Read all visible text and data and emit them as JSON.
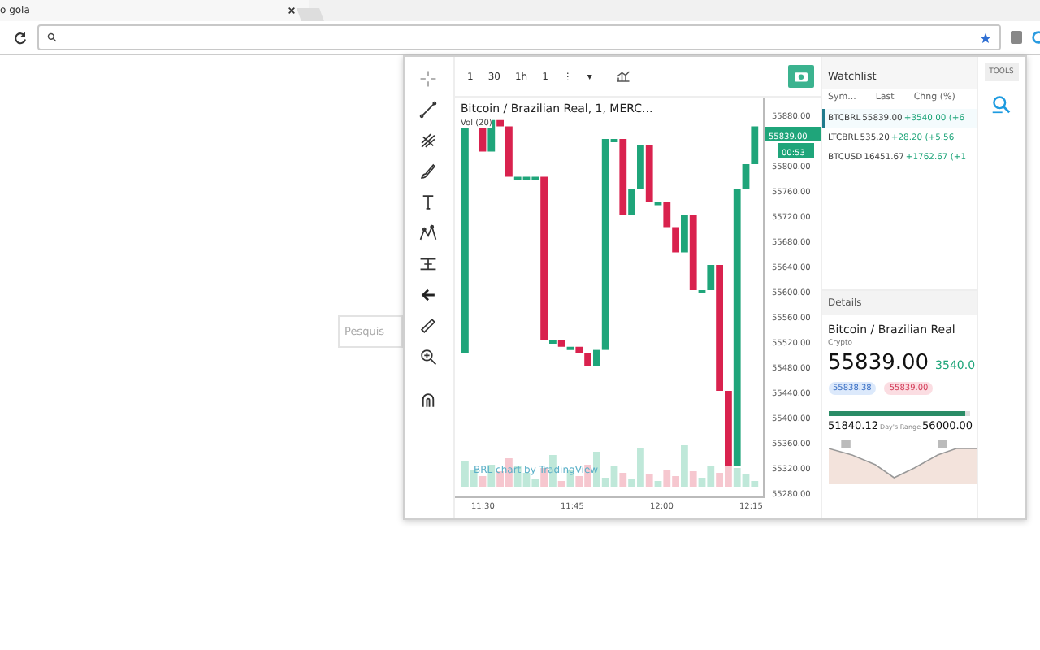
{
  "browser": {
    "tab_title": "o gola"
  },
  "page": {
    "search_placeholder": "Pesquis"
  },
  "chart_toolbar": {
    "items": [
      "1",
      "30",
      "1h",
      "1",
      "⋮",
      "▾"
    ]
  },
  "chart": {
    "legend": "Bitcoin / Brazilian Real, 1, MERC...",
    "volume_label": "Vol (20)",
    "attribution": "BRL chart by TradingView",
    "price_labels": [
      "55880.00",
      "55800.00",
      "55760.00",
      "55720.00",
      "55680.00",
      "55640.00",
      "55600.00",
      "55560.00",
      "55520.00",
      "55480.00",
      "55440.00",
      "55400.00",
      "55360.00",
      "55320.00",
      "55280.00"
    ],
    "last_price": "55839.00",
    "countdown": "00:53",
    "time_labels": [
      "11:30",
      "11:45",
      "12:00",
      "12:15"
    ]
  },
  "watchlist": {
    "title": "Watchlist",
    "columns": [
      "Sym...",
      "Last",
      "Chng (%)"
    ],
    "rows": [
      {
        "symbol": "BTCBRL",
        "last": "55839.00",
        "change": "+3540.00 (+6",
        "selected": true
      },
      {
        "symbol": "LTCBRL",
        "last": "535.20",
        "change": "+28.20 (+5.56",
        "selected": false
      },
      {
        "symbol": "BTCUSD",
        "last": "16451.67",
        "change": "+1762.67 (+1",
        "selected": false
      }
    ]
  },
  "tools_label": "TOOLS",
  "details": {
    "title": "Details",
    "name": "Bitcoin / Brazilian Real",
    "type": "Crypto",
    "price": "55839.00",
    "change": "3540.0",
    "bid": "55838.38",
    "ask": "55839.00",
    "range_low": "51840.12",
    "range_caption": "Day's Range",
    "range_high": "56000.00",
    "level": 0.97
  }
}
